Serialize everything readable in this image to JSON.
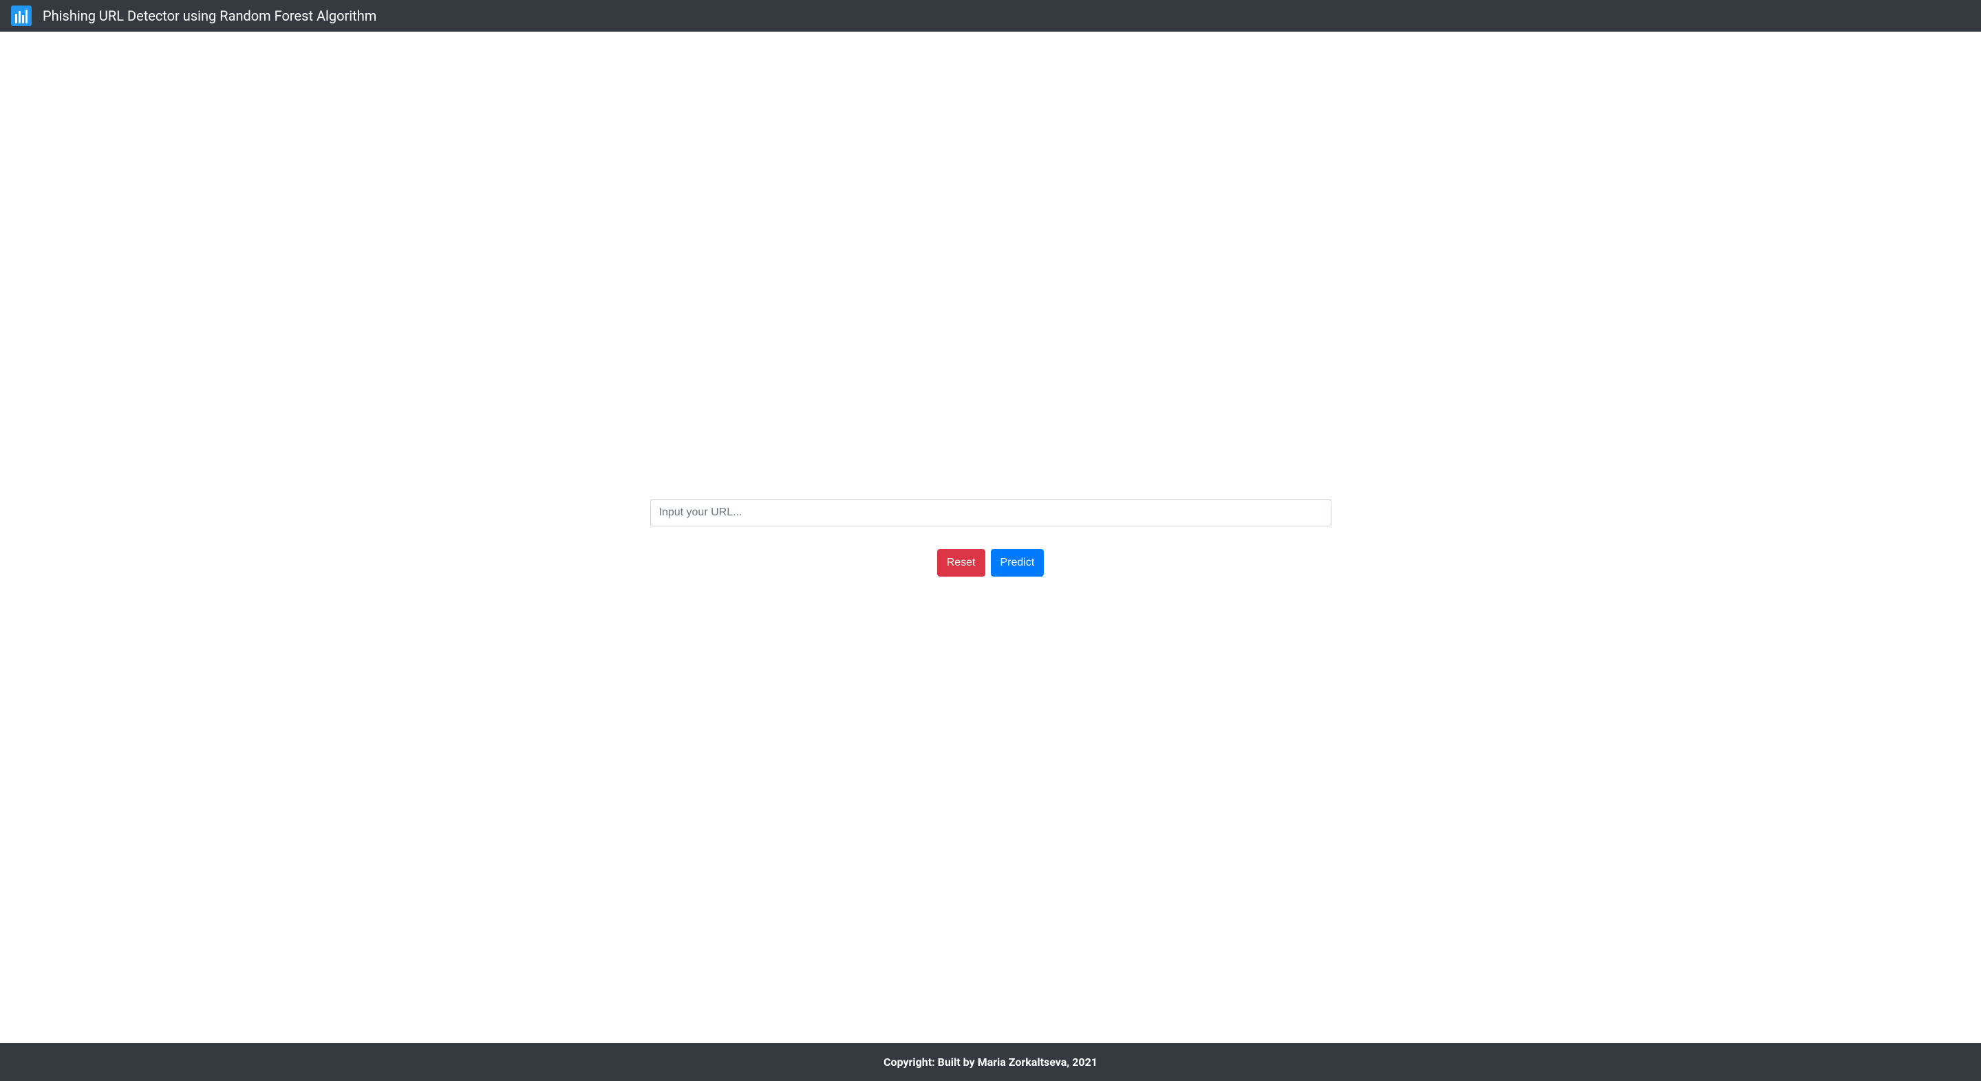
{
  "header": {
    "title": "Phishing URL Detector using Random Forest Algorithm"
  },
  "form": {
    "url_input": {
      "value": "",
      "placeholder": "Input your URL..."
    },
    "buttons": {
      "reset_label": "Reset",
      "predict_label": "Predict"
    }
  },
  "footer": {
    "copyright": "Copyright: Built by Maria Zorkaltseva, 2021"
  }
}
